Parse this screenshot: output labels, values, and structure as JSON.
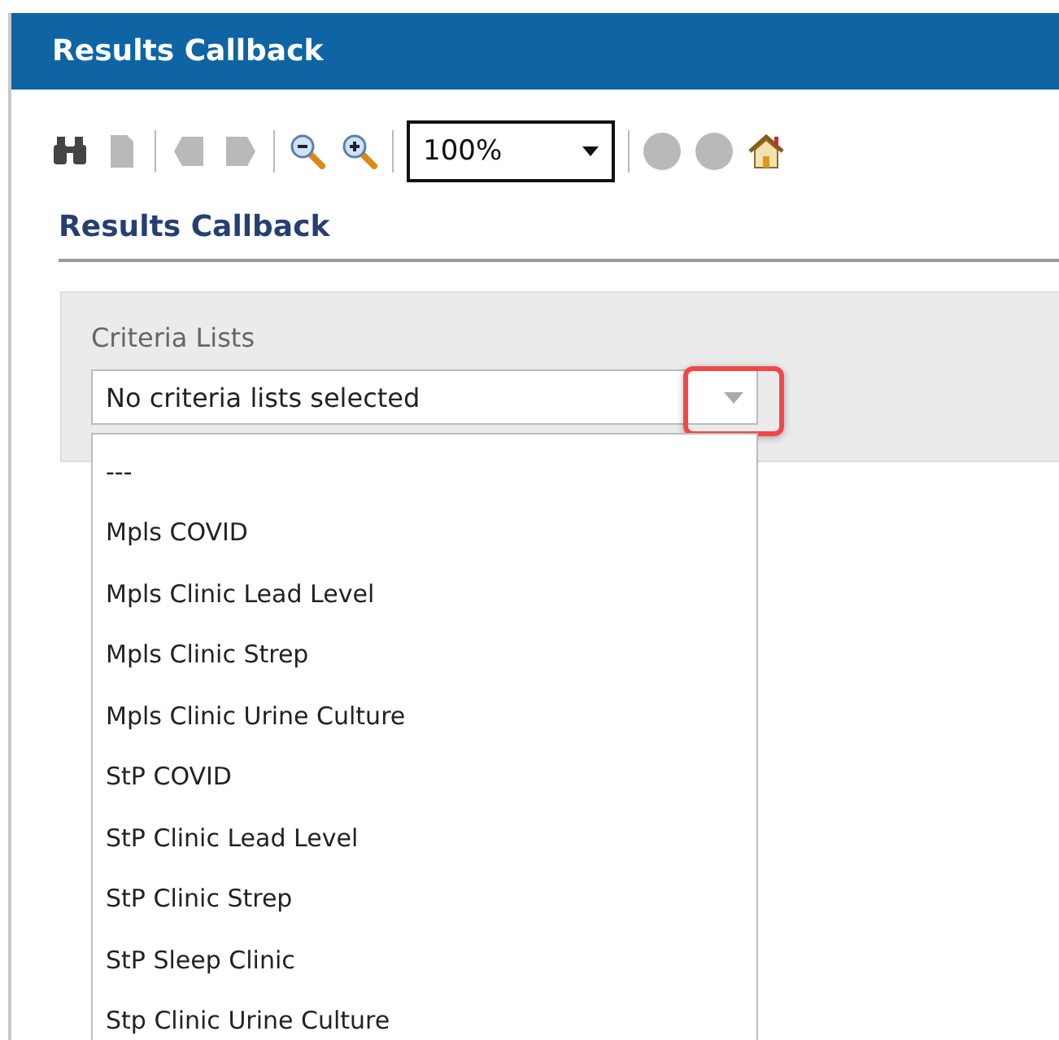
{
  "window": {
    "title": "Results Callback"
  },
  "toolbar": [
    {
      "kind": "find",
      "disabled": false
    },
    {
      "kind": "page",
      "disabled": true
    },
    {
      "kind": "separator"
    },
    {
      "kind": "prev",
      "disabled": true
    },
    {
      "kind": "next",
      "disabled": true
    },
    {
      "kind": "separator"
    },
    {
      "kind": "zoom-out",
      "disabled": false
    },
    {
      "kind": "zoom-in",
      "disabled": false
    },
    {
      "kind": "separator"
    },
    {
      "kind": "zoom-select",
      "value": "100%"
    },
    {
      "kind": "separator"
    },
    {
      "kind": "back",
      "disabled": true
    },
    {
      "kind": "forward",
      "disabled": true
    },
    {
      "kind": "home",
      "disabled": false
    }
  ],
  "heading": "Results Callback",
  "criteria": {
    "label": "Criteria Lists",
    "value": "No criteria lists selected",
    "expanded": true,
    "highlighted": true,
    "options": [
      "---",
      "Mpls COVID",
      "Mpls Clinic Lead Level",
      "Mpls Clinic Strep",
      "Mpls Clinic Urine Culture",
      "StP COVID",
      "StP Clinic Lead Level",
      "StP Clinic Strep",
      "StP Sleep Clinic",
      "Stp Clinic Urine Culture"
    ]
  }
}
